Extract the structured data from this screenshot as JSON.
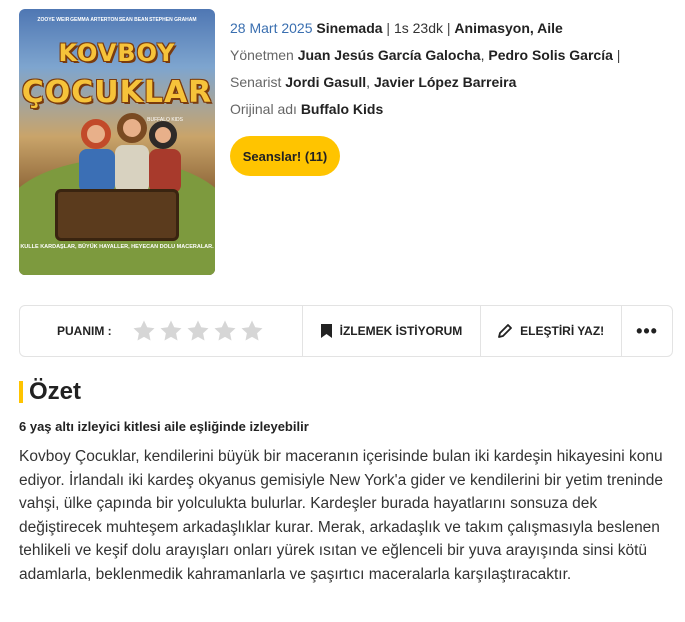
{
  "poster": {
    "actors": [
      "ZOOYE WEIR",
      "GEMMA ARTERTON",
      "SEAN BEAN",
      "STEPHEN GRAHAM"
    ],
    "title_line1": "KOVBOY",
    "title_line2": "ÇOCUKLAR",
    "subtitle": "BUFFALO KIDS",
    "tagline": "KULLE KARDAŞLAR, BÜYÜK HAYALLER, HEYECAN DOLU MACERALAR."
  },
  "info": {
    "date": "28 Mart 2025",
    "release_type": "Sinemada",
    "separator": "|",
    "duration": "1s 23dk",
    "genres": "Animasyon, Aile",
    "director_label": "Yönetmen",
    "director1": "Juan Jesús García Galocha",
    "director2": "Pedro Solis García",
    "writer_label": "Senarist",
    "writer1": "Jordi Gasull",
    "writer2": "Javier López Barreira",
    "original_label": "Orijinal adı",
    "original_title": "Buffalo Kids"
  },
  "seans_button": "Seanslar! (11)",
  "actions": {
    "rating_label": "PUANIM :",
    "rating_value": 0,
    "rating_max": 5,
    "watchlist_label": "İZLEMEK İSTİYORUM",
    "review_label": "ELEŞTİRİ YAZ!",
    "more_label": "•••"
  },
  "summary": {
    "title": "Özet",
    "age_note": "6 yaş altı izleyici kitlesi aile eşliğinde izleyebilir",
    "text": "Kovboy Çocuklar, kendilerini büyük bir maceranın içerisinde bulan iki kardeşin hikayesini konu ediyor. İrlandalı iki kardeş okyanus gemisiyle New York'a gider ve kendilerini bir yetim treninde vahşi, ülke çapında bir yolculukta bulurlar. Kardeşler burada hayatlarını sonsuza dek değiştirecek muhteşem arkadaşlıklar kurar. Merak, arkadaşlık ve takım çalışmasıyla beslenen tehlikeli ve keşif dolu arayışları onları yürek ısıtan ve eğlenceli bir yuva arayışında sinsi kötü adamlarla, beklenmedik kahramanlarla ve şaşırtıcı maceralarla karşılaştıracaktır."
  },
  "colors": {
    "accent": "#ffc400",
    "date_blue": "#3a6fb0",
    "star_empty": "#d6d6d6"
  }
}
